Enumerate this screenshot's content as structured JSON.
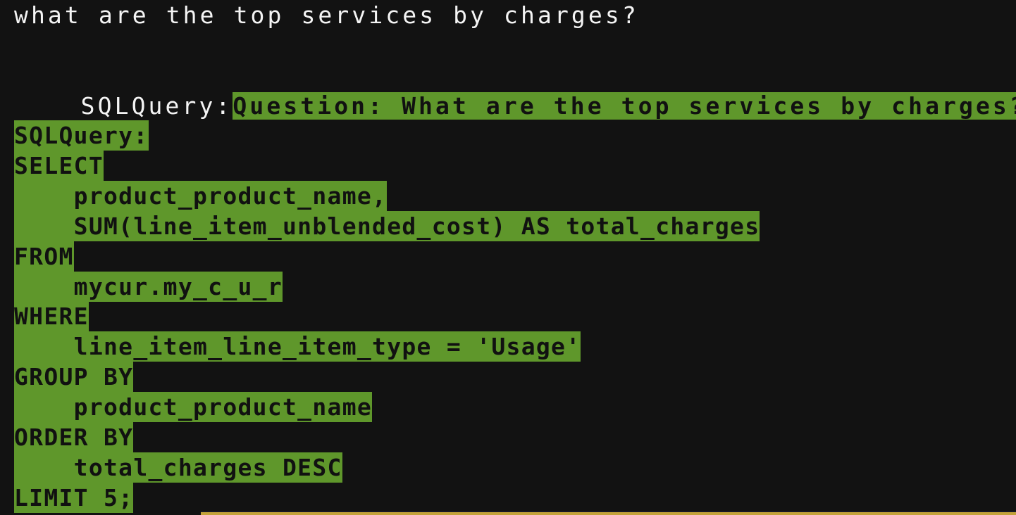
{
  "terminal": {
    "user_prompt": "what are the top services by charges?",
    "answer_label": "SQLQuery:",
    "answer_question": "Question: What are the top services by charges?",
    "sql_lines": [
      "SQLQuery:",
      "SELECT",
      "    product_product_name,",
      "    SUM(line_item_unblended_cost) AS total_charges",
      "FROM",
      "    mycur.my_c_u_r",
      "WHERE",
      "    line_item_line_item_type = 'Usage'",
      "GROUP BY",
      "    product_product_name",
      "ORDER BY",
      "    total_charges DESC",
      "LIMIT 5;"
    ]
  },
  "colors": {
    "background": "#121212",
    "highlight": "#5f972b",
    "status_bar": "#c4a23a"
  }
}
